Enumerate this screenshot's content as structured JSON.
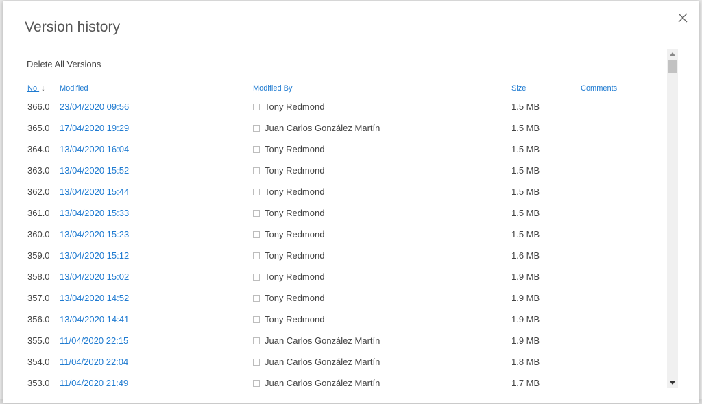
{
  "dialog": {
    "title": "Version history",
    "delete_all_label": "Delete All Versions"
  },
  "icons": {
    "close": "close-icon",
    "sort": "arrow-down-icon"
  },
  "colors": {
    "link": "#1f7bd1",
    "text": "#444444"
  },
  "table": {
    "headers": {
      "no": "No.",
      "modified": "Modified",
      "modified_by": "Modified By",
      "size": "Size",
      "comments": "Comments"
    },
    "rows": [
      {
        "no": "366.0",
        "modified": "23/04/2020 09:56",
        "modified_by": "Tony Redmond",
        "size": "1.5 MB",
        "comments": ""
      },
      {
        "no": "365.0",
        "modified": "17/04/2020 19:29",
        "modified_by": "Juan Carlos González Martín",
        "size": "1.5 MB",
        "comments": ""
      },
      {
        "no": "364.0",
        "modified": "13/04/2020 16:04",
        "modified_by": "Tony Redmond",
        "size": "1.5 MB",
        "comments": ""
      },
      {
        "no": "363.0",
        "modified": "13/04/2020 15:52",
        "modified_by": "Tony Redmond",
        "size": "1.5 MB",
        "comments": ""
      },
      {
        "no": "362.0",
        "modified": "13/04/2020 15:44",
        "modified_by": "Tony Redmond",
        "size": "1.5 MB",
        "comments": ""
      },
      {
        "no": "361.0",
        "modified": "13/04/2020 15:33",
        "modified_by": "Tony Redmond",
        "size": "1.5 MB",
        "comments": ""
      },
      {
        "no": "360.0",
        "modified": "13/04/2020 15:23",
        "modified_by": "Tony Redmond",
        "size": "1.5 MB",
        "comments": ""
      },
      {
        "no": "359.0",
        "modified": "13/04/2020 15:12",
        "modified_by": "Tony Redmond",
        "size": "1.6 MB",
        "comments": ""
      },
      {
        "no": "358.0",
        "modified": "13/04/2020 15:02",
        "modified_by": "Tony Redmond",
        "size": "1.9 MB",
        "comments": ""
      },
      {
        "no": "357.0",
        "modified": "13/04/2020 14:52",
        "modified_by": "Tony Redmond",
        "size": "1.9 MB",
        "comments": ""
      },
      {
        "no": "356.0",
        "modified": "13/04/2020 14:41",
        "modified_by": "Tony Redmond",
        "size": "1.9 MB",
        "comments": ""
      },
      {
        "no": "355.0",
        "modified": "11/04/2020 22:15",
        "modified_by": "Juan Carlos González Martín",
        "size": "1.9 MB",
        "comments": ""
      },
      {
        "no": "354.0",
        "modified": "11/04/2020 22:04",
        "modified_by": "Juan Carlos González Martín",
        "size": "1.8 MB",
        "comments": ""
      },
      {
        "no": "353.0",
        "modified": "11/04/2020 21:49",
        "modified_by": "Juan Carlos González Martín",
        "size": "1.7 MB",
        "comments": ""
      }
    ]
  }
}
